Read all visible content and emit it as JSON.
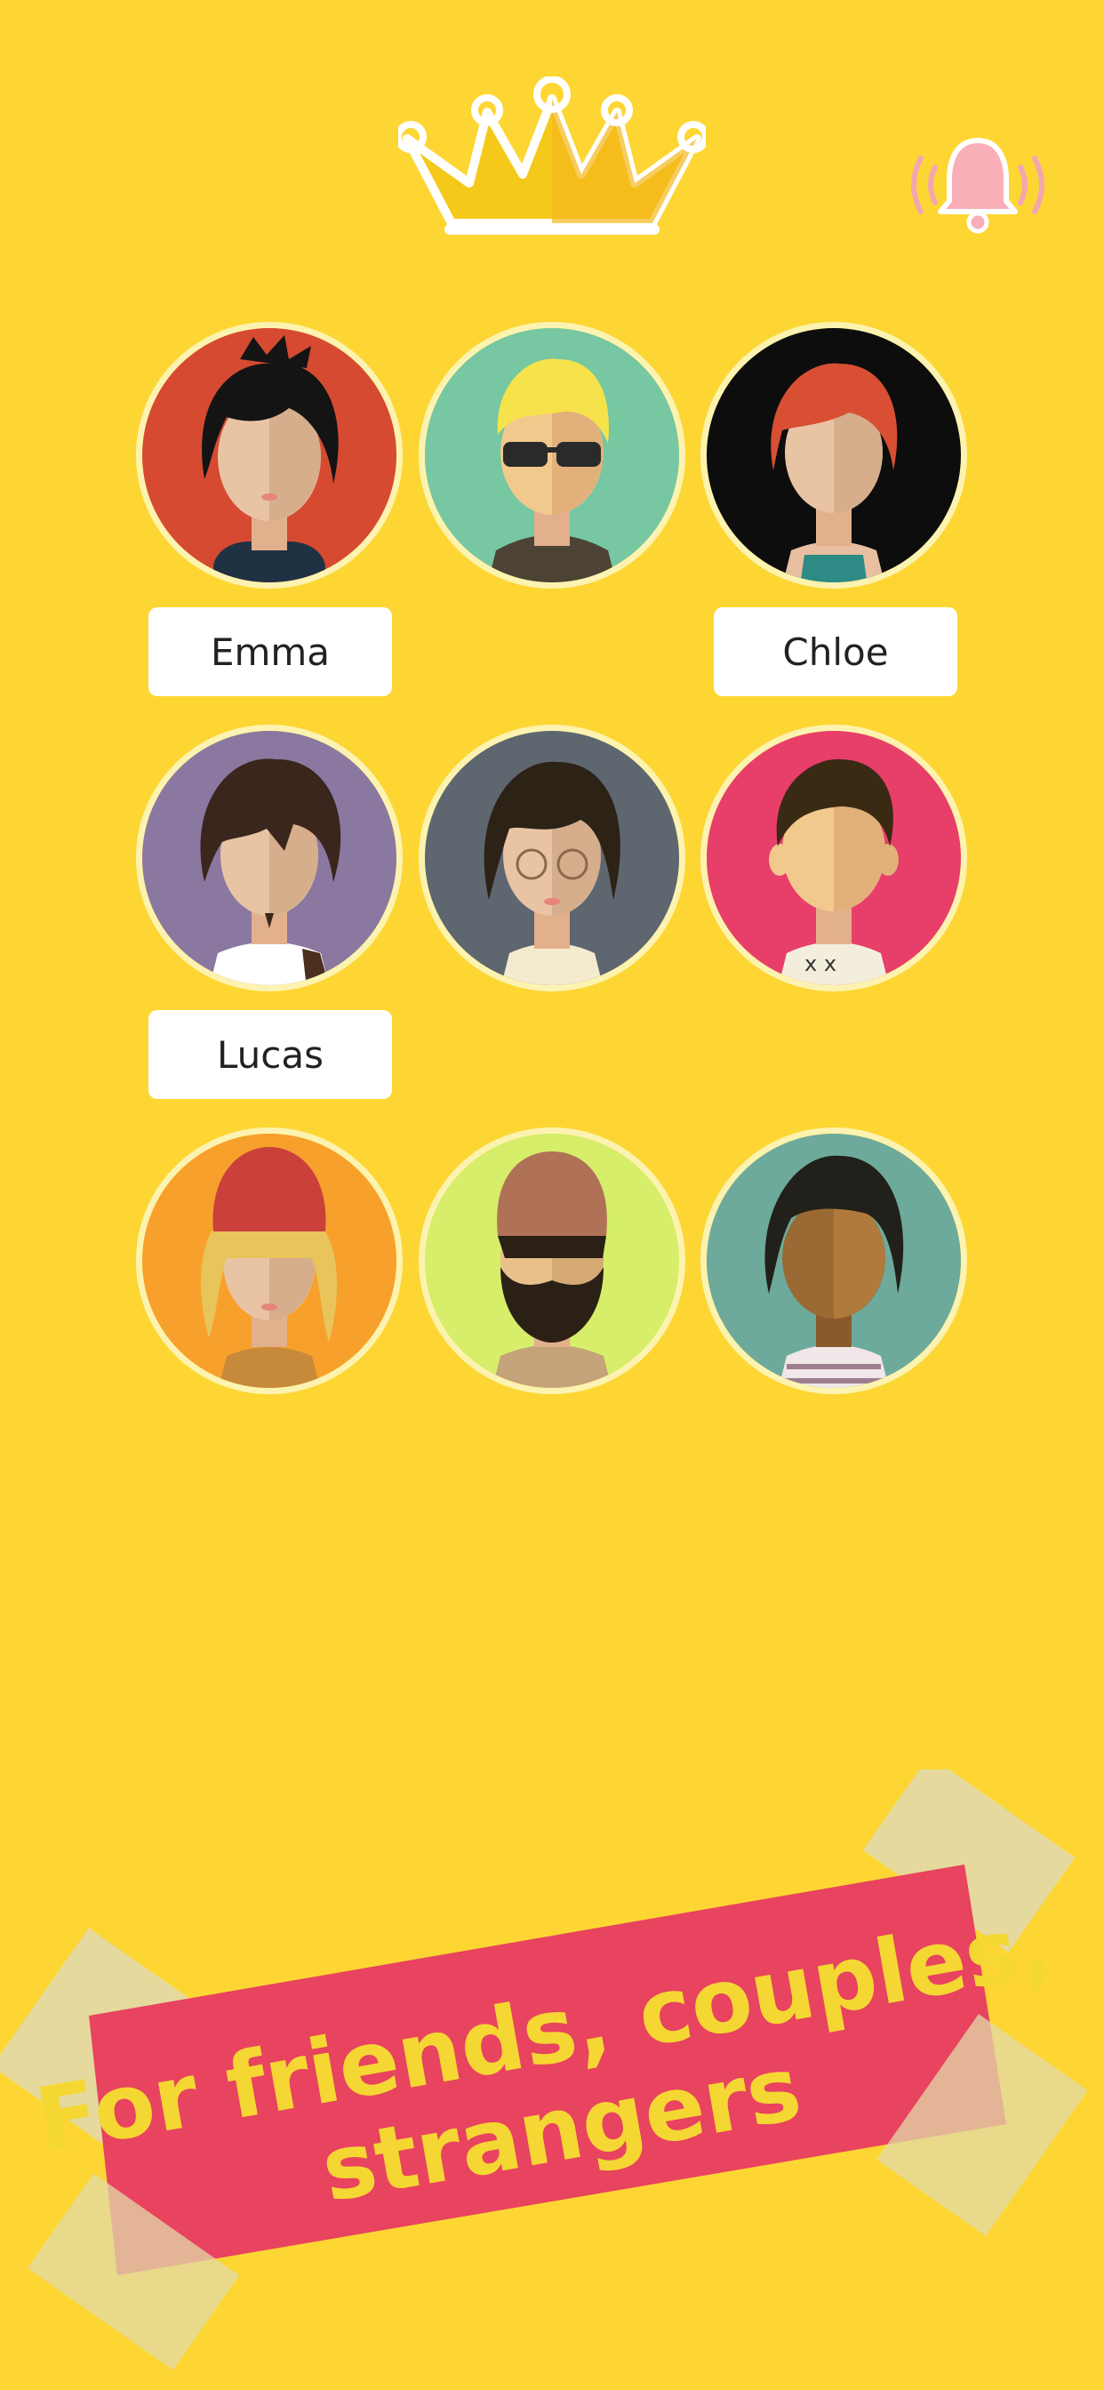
{
  "header": {
    "crown_icon": "crown-icon",
    "alert_icon": "bell-alert-icon"
  },
  "colors": {
    "background": "#FDD633",
    "banner": "#E8435F",
    "banner_text": "#F5D733",
    "tape": "#E2D9A8"
  },
  "avatars": [
    {
      "icon": "avatar-black-hair-woman",
      "bg": "#D64A32",
      "name": "Emma"
    },
    {
      "icon": "avatar-blonde-sunglasses-man",
      "bg": "#76C7A2",
      "name": ""
    },
    {
      "icon": "avatar-red-hair-woman",
      "bg": "#0D0D0D",
      "name": "Chloe"
    },
    {
      "icon": "avatar-messy-hair-man",
      "bg": "#8B78A0",
      "name": "Lucas"
    },
    {
      "icon": "avatar-glasses-woman",
      "bg": "#5E6670",
      "name": ""
    },
    {
      "icon": "avatar-freckled-boy",
      "bg": "#E83E6A",
      "name": ""
    },
    {
      "icon": "avatar-beanie-blonde-woman",
      "bg": "#F7A02C",
      "name": ""
    },
    {
      "icon": "avatar-bearded-beanie-man",
      "bg": "#D6EE6A",
      "name": ""
    },
    {
      "icon": "avatar-curly-hair-man",
      "bg": "#6DAA9B",
      "name": ""
    }
  ],
  "banner": {
    "line1": "For friends, couples,",
    "line2": "strangers"
  }
}
